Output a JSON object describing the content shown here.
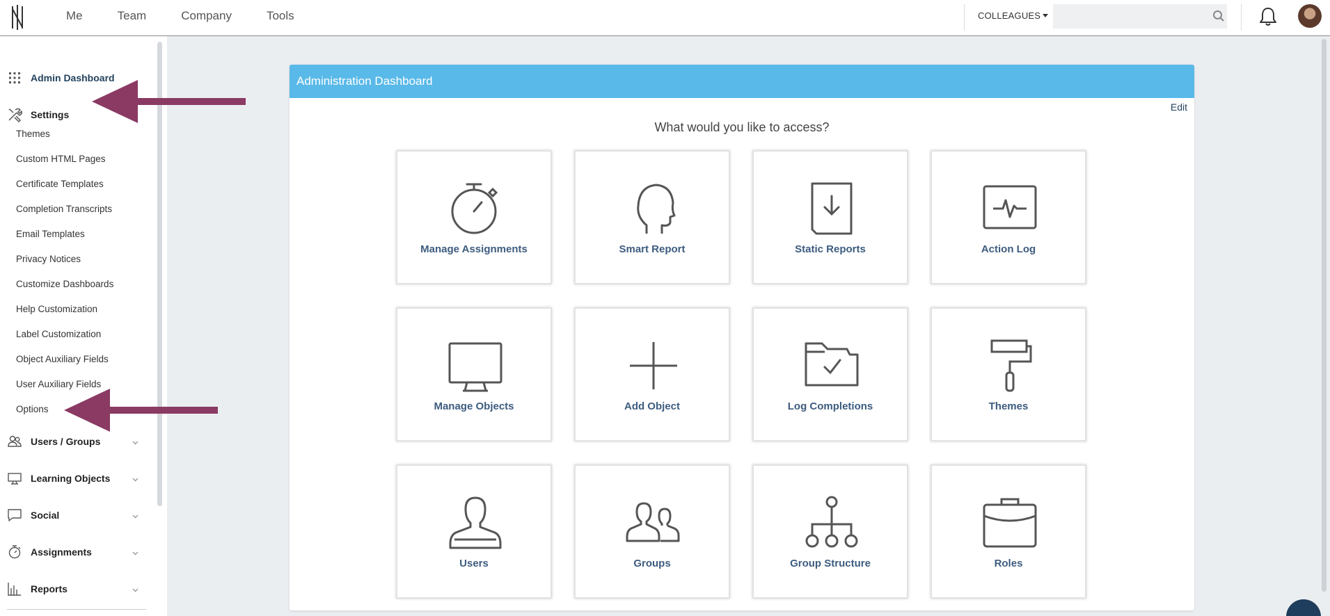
{
  "topnav": {
    "items": [
      "Me",
      "Team",
      "Company",
      "Tools"
    ],
    "colleagues_label": "COLLEAGUES",
    "search_placeholder": "",
    "icons": [
      "logo-icon",
      "search-icon",
      "bell-icon",
      "avatar"
    ]
  },
  "sidebar": {
    "admin_dashboard": "Admin Dashboard",
    "settings": "Settings",
    "settings_items": [
      "Themes",
      "Custom HTML Pages",
      "Certificate Templates",
      "Completion Transcripts",
      "Email Templates",
      "Privacy Notices",
      "Customize Dashboards",
      "Help Customization",
      "Label Customization",
      "Object Auxiliary Fields",
      "User Auxiliary Fields",
      "Options"
    ],
    "sections": [
      "Users / Groups",
      "Learning Objects",
      "Social",
      "Assignments",
      "Reports"
    ]
  },
  "colors": {
    "header_blue": "#59b9e8",
    "link_navy": "#3d5c7f",
    "arrow": "#8a3a63"
  },
  "panel": {
    "title": "Administration Dashboard",
    "edit_label": "Edit",
    "prompt": "What would you like to access?",
    "tiles": [
      {
        "label": "Manage Assignments",
        "icon": "stopwatch-icon"
      },
      {
        "label": "Smart Report",
        "icon": "head-icon"
      },
      {
        "label": "Static Reports",
        "icon": "document-download-icon"
      },
      {
        "label": "Action Log",
        "icon": "pulse-monitor-icon"
      },
      {
        "label": "Manage Objects",
        "icon": "monitor-icon"
      },
      {
        "label": "Add Object",
        "icon": "plus-icon"
      },
      {
        "label": "Log Completions",
        "icon": "folder-check-icon"
      },
      {
        "label": "Themes",
        "icon": "paint-roller-icon"
      },
      {
        "label": "Users",
        "icon": "user-icon"
      },
      {
        "label": "Groups",
        "icon": "users-icon"
      },
      {
        "label": "Group Structure",
        "icon": "hierarchy-icon"
      },
      {
        "label": "Roles",
        "icon": "briefcase-icon"
      }
    ]
  }
}
